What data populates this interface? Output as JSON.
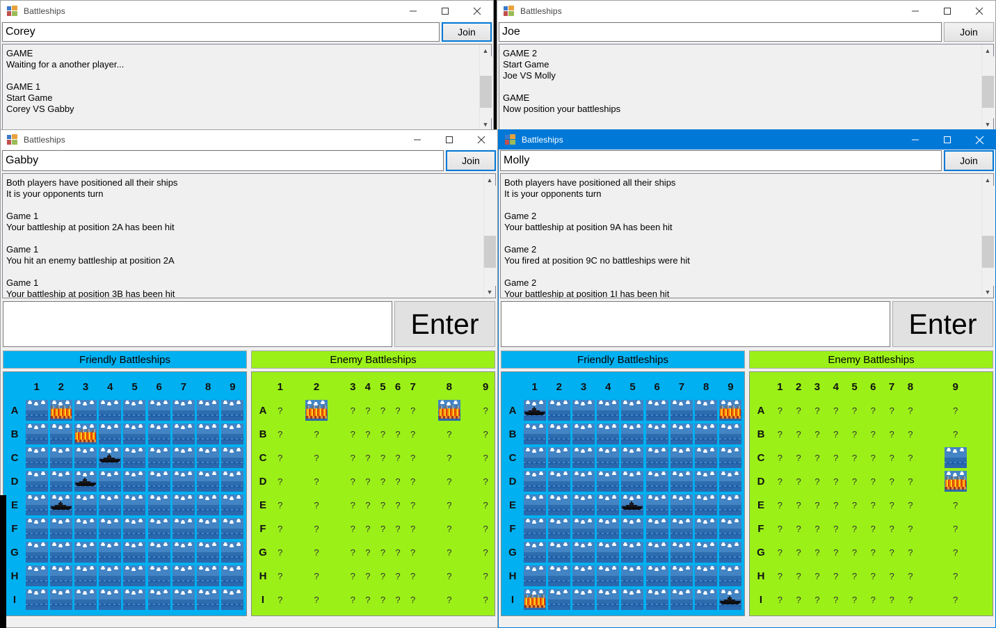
{
  "app": {
    "title": "Battleships",
    "window_controls": {
      "minimize": "minimize-icon",
      "maximize": "maximize-icon",
      "close": "close-icon"
    }
  },
  "common": {
    "join_label": "Join",
    "enter_label": "Enter",
    "friendly_header": "Friendly Battleships",
    "enemy_header": "Enemy Battleships",
    "message_placeholder": "",
    "message_value": "",
    "columns": [
      "1",
      "2",
      "3",
      "4",
      "5",
      "6",
      "7",
      "8",
      "9"
    ],
    "rows": [
      "A",
      "B",
      "C",
      "D",
      "E",
      "F",
      "G",
      "H",
      "I"
    ],
    "unknown_marker": "?"
  },
  "colors": {
    "friendly_board": "#00b0f0",
    "enemy_board": "#9bf018",
    "active_titlebar": "#0078d7",
    "water": "#3a77bd",
    "fire": "#ff7a00",
    "ship": "#0d0d10"
  },
  "windows": {
    "corey": {
      "title": "Battleships",
      "active": false,
      "player_name": "Corey",
      "join_focused": true,
      "log": "GAME\nWaiting for a another player...\n\nGAME 1\nStart Game\nCorey VS Gabby"
    },
    "joe": {
      "title": "Battleships",
      "active": false,
      "player_name": "Joe",
      "join_focused": false,
      "log": "GAME 2\nStart Game\nJoe VS Molly\n\nGAME\nNow position your battleships"
    },
    "gabby": {
      "title": "Battleships",
      "active": false,
      "player_name": "Gabby",
      "join_focused": true,
      "log": "Both players have positioned all their ships\nIt is your opponents turn\n\nGame 1\nYour battleship at position 2A has been hit\n\nGame 1\nYou hit an enemy battleship at position 2A\n\nGame 1\nYour battleship at position 3B has been hit",
      "message_value": "",
      "friendly_board": {
        "ships": [
          "4C",
          "3D",
          "2E"
        ],
        "hits": [
          "2A",
          "3B"
        ]
      },
      "enemy_board": {
        "hits": [
          "2A",
          "8A"
        ],
        "misses": []
      }
    },
    "molly": {
      "title": "Battleships",
      "active": true,
      "player_name": "Molly",
      "join_focused": true,
      "log": "Both players have positioned all their ships\nIt is your opponents turn\n\nGame 2\nYour battleship at position 9A has been hit\n\nGame 2\nYou fired at position 9C no battleships were hit\n\nGame 2\nYour battleship at position 1I has been hit",
      "message_value": "",
      "friendly_board": {
        "ships": [
          "1A",
          "5E",
          "9I"
        ],
        "hits": [
          "9A",
          "1I"
        ]
      },
      "enemy_board": {
        "hits": [
          "9D"
        ],
        "misses": [
          "9C"
        ]
      }
    }
  }
}
